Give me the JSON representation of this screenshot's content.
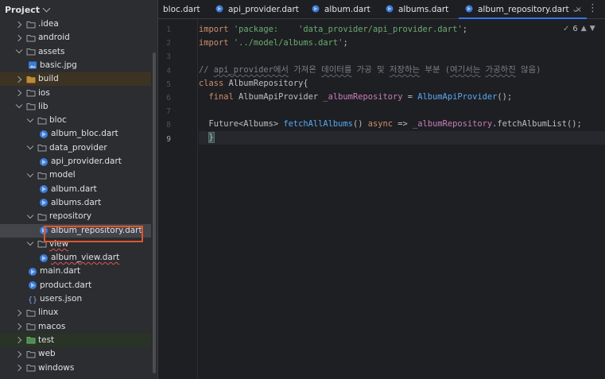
{
  "project_panel": {
    "title": "Project",
    "tree": [
      {
        "label": ".idea",
        "type": "folder",
        "indent": 1,
        "state": "collapsed"
      },
      {
        "label": "android",
        "type": "folder",
        "indent": 1,
        "state": "collapsed"
      },
      {
        "label": "assets",
        "type": "folder",
        "indent": 1,
        "state": "expanded"
      },
      {
        "label": "basic.jpg",
        "type": "image",
        "indent": 2,
        "state": "leaf"
      },
      {
        "label": "build",
        "type": "folder-excluded",
        "indent": 1,
        "state": "collapsed",
        "highlight": "brown"
      },
      {
        "label": "ios",
        "type": "folder",
        "indent": 1,
        "state": "collapsed"
      },
      {
        "label": "lib",
        "type": "folder",
        "indent": 1,
        "state": "expanded"
      },
      {
        "label": "bloc",
        "type": "folder",
        "indent": 2,
        "state": "expanded"
      },
      {
        "label": "album_bloc.dart",
        "type": "dart",
        "indent": 3,
        "state": "leaf"
      },
      {
        "label": "data_provider",
        "type": "folder",
        "indent": 2,
        "state": "expanded"
      },
      {
        "label": "api_provider.dart",
        "type": "dart",
        "indent": 3,
        "state": "leaf"
      },
      {
        "label": "model",
        "type": "folder",
        "indent": 2,
        "state": "expanded"
      },
      {
        "label": "album.dart",
        "type": "dart",
        "indent": 3,
        "state": "leaf"
      },
      {
        "label": "albums.dart",
        "type": "dart",
        "indent": 3,
        "state": "leaf"
      },
      {
        "label": "repository",
        "type": "folder",
        "indent": 2,
        "state": "expanded"
      },
      {
        "label": "album_repository.dart",
        "type": "dart",
        "indent": 3,
        "state": "leaf",
        "selected": true
      },
      {
        "label": "view",
        "type": "folder",
        "indent": 2,
        "state": "expanded",
        "error": true
      },
      {
        "label": "album_view.dart",
        "type": "dart",
        "indent": 3,
        "state": "leaf",
        "error": true
      },
      {
        "label": "main.dart",
        "type": "dart",
        "indent": 2,
        "state": "leaf"
      },
      {
        "label": "product.dart",
        "type": "dart",
        "indent": 2,
        "state": "leaf"
      },
      {
        "label": "users.json",
        "type": "json",
        "indent": 2,
        "state": "leaf"
      },
      {
        "label": "linux",
        "type": "folder",
        "indent": 1,
        "state": "collapsed"
      },
      {
        "label": "macos",
        "type": "folder",
        "indent": 1,
        "state": "collapsed"
      },
      {
        "label": "test",
        "type": "folder-test",
        "indent": 1,
        "state": "collapsed",
        "highlight": "green"
      },
      {
        "label": "web",
        "type": "folder",
        "indent": 1,
        "state": "collapsed"
      },
      {
        "label": "windows",
        "type": "folder",
        "indent": 1,
        "state": "collapsed"
      }
    ]
  },
  "tabs": [
    {
      "label": "bloc.dart",
      "active": false,
      "icon": false
    },
    {
      "label": "api_provider.dart",
      "active": false,
      "icon": true
    },
    {
      "label": "album.dart",
      "active": false,
      "icon": true
    },
    {
      "label": "albums.dart",
      "active": false,
      "icon": true
    },
    {
      "label": "album_repository.dart",
      "active": true,
      "icon": true
    }
  ],
  "tab_close_glyph": "×",
  "tab_menu_glyph": "⌄",
  "tab_more_glyph": "⋮",
  "inspections": {
    "count": "6"
  },
  "line_numbers": [
    "1",
    "2",
    "3",
    "4",
    "5",
    "6",
    "7",
    "8",
    "9"
  ],
  "current_line": "9",
  "code": {
    "l1_kw": "import",
    "l1_str": "'package:    'data_provider/api_provider.dart'",
    "l1_end": ";",
    "l2_kw": "import",
    "l2_str": "'../model/albums.dart'",
    "l2_end": ";",
    "l4_comment_a": "// ",
    "l4_comment_b": "api_provider에서",
    "l4_comment_c": " 가져온 ",
    "l4_comment_d": "데이터를",
    "l4_comment_e": " 가공 및 ",
    "l4_comment_f": "저장하는",
    "l4_comment_g": " 부분 (",
    "l4_comment_h": "여기서는",
    "l4_comment_i": " ",
    "l4_comment_j": "가공하진",
    "l4_comment_k": " 않음)",
    "l5_kw": "class",
    "l5_name": " AlbumRepository",
    "l5_brace": "{",
    "l6_kw": "final",
    "l6_type": " AlbumApiProvider ",
    "l6_field": "_albumRepository",
    "l6_eq": " = ",
    "l6_ctor": "AlbumApiProvider",
    "l6_end": "();",
    "l8_type": "Future<Albums> ",
    "l8_fn": "fetchAllAlbums",
    "l8_mid": "() ",
    "l8_kw": "async",
    "l8_arrow": " => ",
    "l8_field": "_albumRepository",
    "l8_call": ".fetchAlbumList();",
    "l9_brace": "}"
  },
  "colors": {
    "accent": "#3574f0",
    "selection_box": "#e0562b",
    "dart_icon": "#3d7bd8",
    "folder": "#9da0a8",
    "keyword": "#cf8e6d",
    "string": "#6aab73",
    "function": "#56a8f5",
    "field": "#c77dbb",
    "comment": "#7a7e85"
  }
}
